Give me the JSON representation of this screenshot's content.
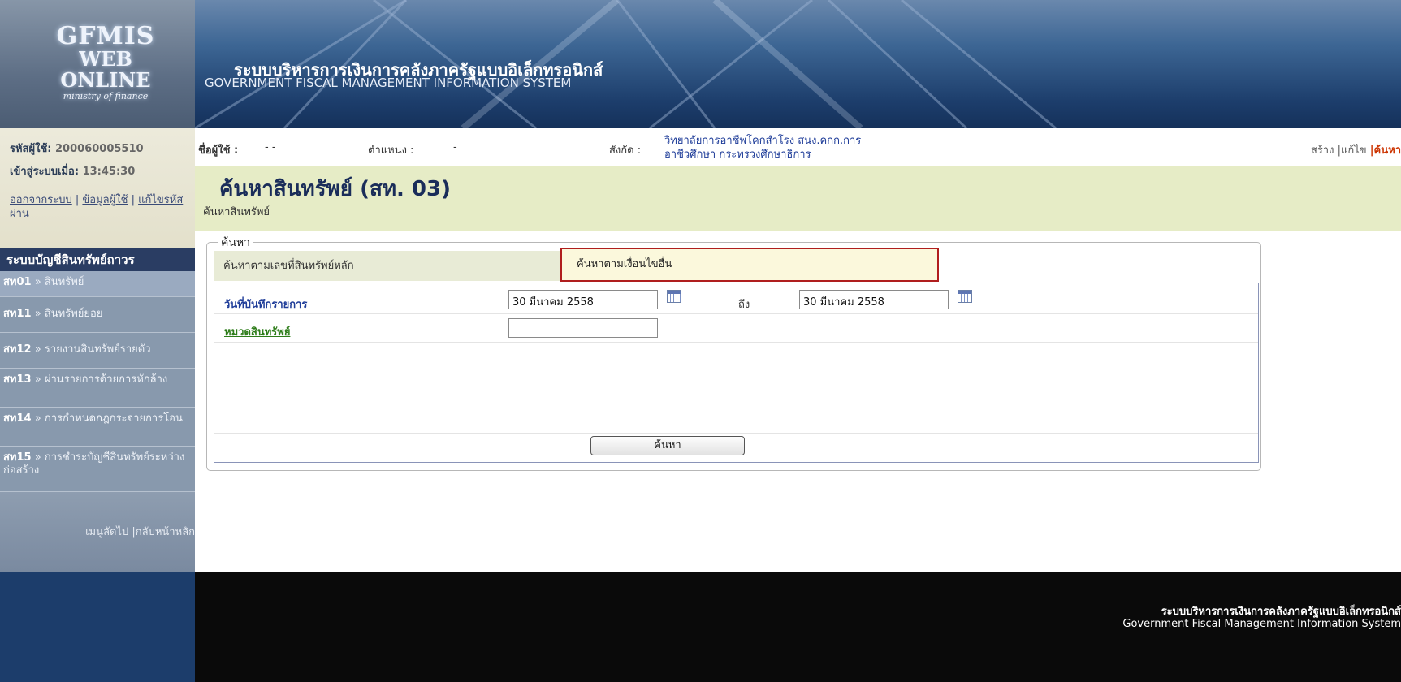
{
  "header": {
    "logo_line1": "GFMIS",
    "logo_line2": "WEB ONLINE",
    "logo_line3": "ministry of finance",
    "title_th": "ระบบบริหารการเงินการคลังภาครัฐแบบอิเล็กทรอนิกส์",
    "title_en": "GOVERNMENT FISCAL MANAGEMENT INFORMATION SYSTEM"
  },
  "user": {
    "id_label": "รหัสผู้ใช้:",
    "id_value": "200060005510",
    "login_label": "เข้าสู่ระบบเมื่อ:",
    "login_time": "13:45:30",
    "logout": "ออกจากระบบ",
    "sep1": " | ",
    "profile": "ข้อมูลผู้ใช้",
    "sep2": " | ",
    "change_password": "แก้ไขรหัสผ่าน"
  },
  "menu": {
    "title": "ระบบบัญชีสินทรัพย์ถาวร",
    "items": [
      {
        "code": "สท01",
        "label": "สินทรัพย์"
      },
      {
        "code": "สท11",
        "label": "สินทรัพย์ย่อย"
      },
      {
        "code": "สท12",
        "label": "รายงานสินทรัพย์รายตัว"
      },
      {
        "code": "สท13",
        "label": "ผ่านรายการด้วยการหักล้าง"
      },
      {
        "code": "สท14",
        "label": "การกำหนดกฎกระจายการโอน"
      },
      {
        "code": "สท15",
        "label": "การชำระบัญชีสินทรัพย์ระหว่างก่อสร้าง"
      }
    ],
    "arrow": "»",
    "footer_shortcut": "เมนูลัดไป",
    "footer_home": "|กลับหน้าหลัก"
  },
  "infobar": {
    "user_label": "ชื่อผู้ใช้ :",
    "user_value": "- -",
    "position_label": "ตำแหน่ง :",
    "position_value": "-",
    "dept_label": "สังกัด :",
    "dept_line1": "วิทยาลัยการอาชีพโคกสำโรง สนง.คกก.การ",
    "dept_line2": "อาชีวศึกษา กระทรวงศึกษาธิการ",
    "action_create": "สร้าง",
    "action_edit": "|แก้ไข",
    "action_search": "|ค้นหา"
  },
  "page": {
    "title": "ค้นหาสินทรัพย์ (สท. 03)",
    "subtitle": "ค้นหาสินทรัพย์"
  },
  "search": {
    "legend": "ค้นหา",
    "tab_main": "ค้นหาตามเลขที่สินทรัพย์หลัก",
    "tab_other": "ค้นหาตามเงื่อนไขอื่น",
    "date_label": "วันที่บันทึกรายการ",
    "date_from": "30 มีนาคม 2558",
    "to_label": "ถึง",
    "date_to": "30 มีนาคม 2558",
    "category_label": "หมวดสินทรัพย์",
    "category_value": "",
    "button": "ค้นหา"
  },
  "footer": {
    "th": "ระบบบริหารการเงินการคลังภาครัฐแบบอิเล็กทรอนิกส์",
    "en": "Government Fiscal Management Information System"
  },
  "colors": {
    "header_blue": "#1c3d6b",
    "title_band": "#e6ecc6",
    "highlight_border": "#b01e1e",
    "link_blue": "#1f3d99",
    "link_green": "#2e7d1a",
    "active_link": "#cc3300"
  }
}
